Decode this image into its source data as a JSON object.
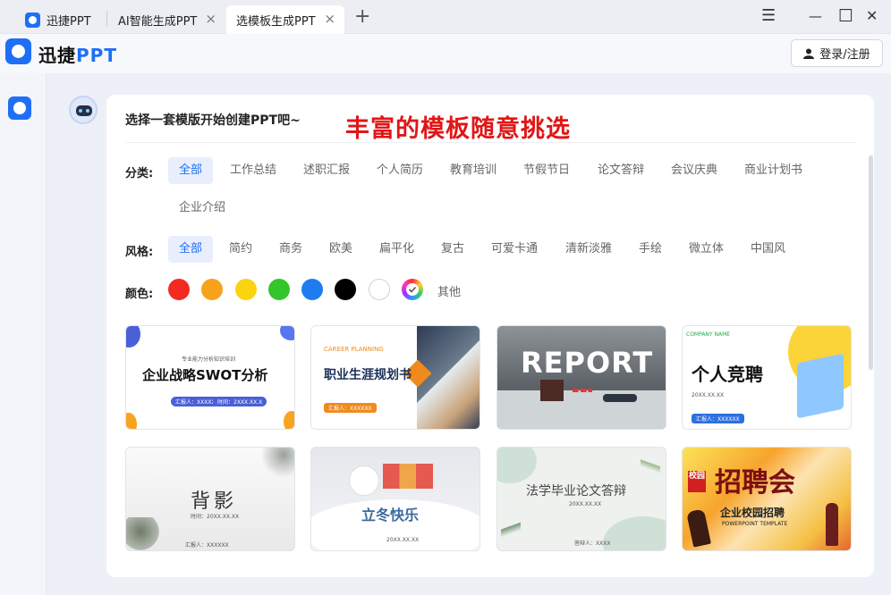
{
  "tabs": [
    {
      "label": "迅捷PPT"
    },
    {
      "label": "AI智能生成PPT"
    },
    {
      "label": "选模板生成PPT"
    }
  ],
  "window_controls": {
    "menu": "☰",
    "minimize": "—",
    "maximize": "☐",
    "close": "✕"
  },
  "header": {
    "logo_prefix": "迅捷",
    "logo_brand": "PPT",
    "login_label": "登录/注册"
  },
  "main": {
    "prompt": "选择一套模版开始创建PPT吧~",
    "banner": "丰富的模板随意挑选"
  },
  "filters": {
    "category_label": "分类:",
    "categories": [
      "全部",
      "工作总结",
      "述职汇报",
      "个人简历",
      "教育培训",
      "节假节日",
      "论文答辩",
      "会议庆典",
      "商业计划书",
      "企业介绍"
    ],
    "style_label": "风格:",
    "styles": [
      "全部",
      "简约",
      "商务",
      "欧美",
      "扁平化",
      "复古",
      "可爱卡通",
      "清新淡雅",
      "手绘",
      "微立体",
      "中国风"
    ],
    "color_label": "颜色:",
    "colors": [
      "#f22a22",
      "#f7a21b",
      "#fbd410",
      "#34c52a",
      "#1f7cf0",
      "#000000",
      "#ffffff"
    ],
    "color_other": "其他",
    "selected_category": "全部",
    "selected_style": "全部"
  },
  "templates": [
    {
      "title": "企业战略SWOT分析",
      "subtitle": "专业能力分析知识培训",
      "tag1": "汇报人：XXXXX",
      "tag2": "时间：2XXX.XX.X"
    },
    {
      "kicker": "CAREER PLANNING",
      "title": "职业生涯规划书",
      "tag": "汇报人：XXXXXX"
    },
    {
      "title": "REPORT"
    },
    {
      "kicker": "COMPANY NAME",
      "title": "个人竞聘",
      "sub": "20XX.XX.XX",
      "tag": "汇报人：XXXXXX"
    },
    {
      "title": "背影",
      "sub": "汇报人：XXXXXX",
      "sub2": "时间：20XX.XX.XX"
    },
    {
      "title": "立冬快乐",
      "sub": "20XX.XX.XX"
    },
    {
      "title": "法学毕业论文答辩",
      "sub": "20XX.XX.XX",
      "tag": "答辩人：XXXX"
    },
    {
      "title": "企业校园招聘",
      "big": "招聘会",
      "seal": "校园",
      "en": "POWERPOINT TEMPLATE"
    }
  ]
}
